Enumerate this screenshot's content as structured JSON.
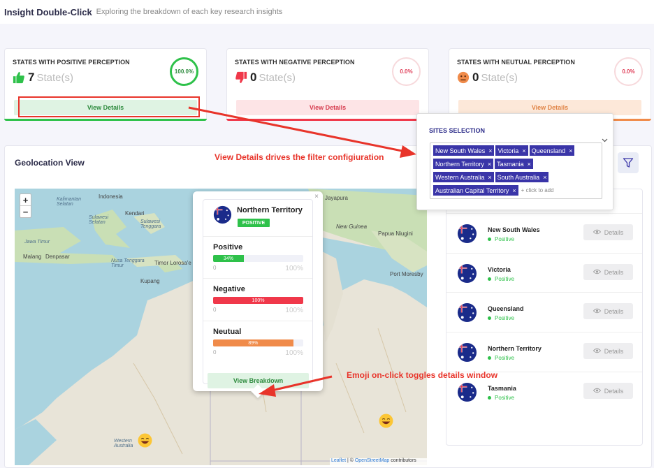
{
  "header": {
    "title": "Insight Double-Click",
    "subtitle": "Exploring the breakdown of each key research insights"
  },
  "cards": {
    "positive": {
      "title": "STATES WITH POSITIVE PERCEPTION",
      "count": "7",
      "unit": "State(s)",
      "percent": "100.0%",
      "button": "View Details",
      "icon": "thumbs-up-icon",
      "color": "#2ec14a"
    },
    "negative": {
      "title": "STATES WITH NEGATIVE PERCEPTION",
      "count": "0",
      "unit": "State(s)",
      "percent": "0.0%",
      "button": "View Details",
      "icon": "thumbs-down-icon",
      "color": "#f0384a"
    },
    "neutral": {
      "title": "STATES WITH NEUTUAL PERCEPTION",
      "count": "0",
      "unit": "State(s)",
      "percent": "0.0%",
      "button": "View Details",
      "icon": "neutral-face-icon",
      "color": "#f08b4a"
    }
  },
  "geo": {
    "title": "Geolocation View"
  },
  "map": {
    "zoom_in": "+",
    "zoom_out": "−",
    "labels": {
      "indonesia": "Indonesia",
      "kalimantan": "Kalimantan\nSelatan",
      "kendari": "Kendari",
      "sulawesi": "Sulawesi\nSelatan",
      "sulawesi_tenggara": "Sulawesi\nTenggara",
      "jawa_timur": "Jawa Timur",
      "malang": "Malang",
      "denpasar": "Denpasar",
      "nusa_tenggara": "Nusa Tenggara\nTimur",
      "timor": "Timor Lorosa'e",
      "kupang": "Kupang",
      "jayapura": "Jayapura",
      "new_guinea": "New Guinea",
      "papua": "Papua Niugini",
      "port_moresby": "Port Moresby",
      "western_australia": "Western\nAustralia"
    },
    "attribution_leaflet": "Leaflet",
    "attribution_sep": " | © ",
    "attribution_osm": "OpenStreetMap",
    "attribution_tail": " contributors"
  },
  "popup": {
    "close": "×",
    "state": "Northern Territory",
    "badge": "POSITIVE",
    "sections": [
      {
        "label": "Positive",
        "percent": "34%",
        "value": 34,
        "color": "#2ec14a",
        "min": "0",
        "max": "100%"
      },
      {
        "label": "Negative",
        "percent": "100%",
        "value": 100,
        "color": "#f0384a",
        "min": "0",
        "max": "100%"
      },
      {
        "label": "Neutual",
        "percent": "89%",
        "value": 89,
        "color": "#f08b4a",
        "min": "0",
        "max": "100%"
      }
    ],
    "button": "View Breakdown"
  },
  "states_list": [
    {
      "name": "New South Wales",
      "status": "Positive",
      "button": "Details"
    },
    {
      "name": "Victoria",
      "status": "Positive",
      "button": "Details"
    },
    {
      "name": "Queensland",
      "status": "Positive",
      "button": "Details"
    },
    {
      "name": "Northern Territory",
      "status": "Positive",
      "button": "Details"
    },
    {
      "name": "Tasmania",
      "status": "Positive",
      "button": "Details"
    }
  ],
  "sites": {
    "title": "SITES SELECTION",
    "tags": [
      "New South Wales",
      "Victoria",
      "Queensland",
      "Northern Territory",
      "Tasmania",
      "Western Australia",
      "South Australia",
      "Australian Capital Territory"
    ],
    "remove": "×",
    "placeholder": "click to add"
  },
  "annotations": {
    "view_details": "View Details drives the filter configiuration",
    "emoji": "Emoji on-click toggles details window"
  },
  "colors": {
    "accent": "#3a35a8",
    "positive": "#2ec14a",
    "negative": "#f0384a",
    "neutral": "#f08b4a",
    "annotation": "#e8342a"
  }
}
